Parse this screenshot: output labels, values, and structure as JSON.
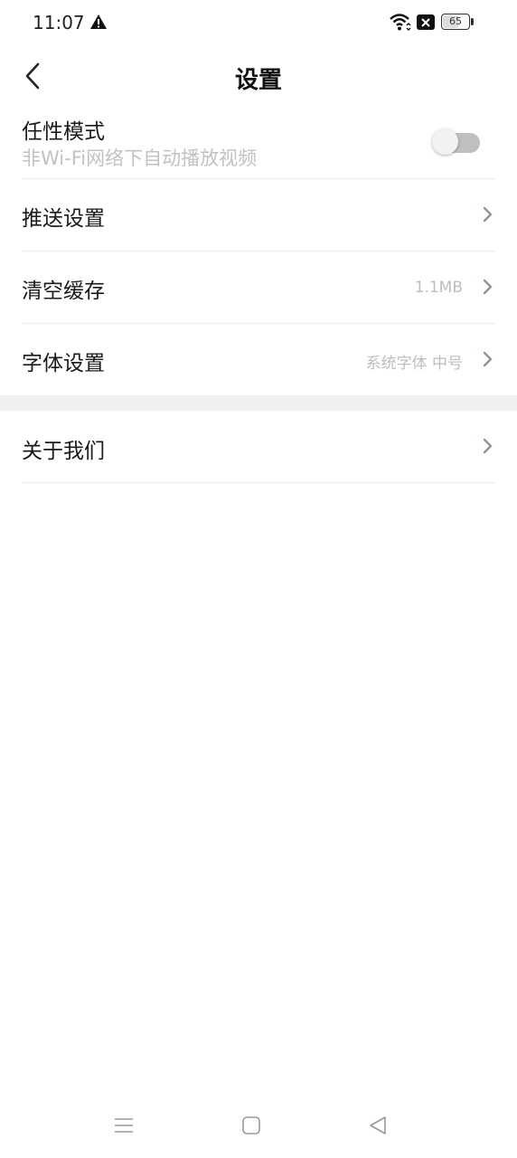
{
  "status": {
    "time": "11:07",
    "battery": "65",
    "icons": [
      "warning-icon",
      "wifi-icon",
      "no-sim-icon",
      "battery-icon"
    ]
  },
  "header": {
    "title": "设置",
    "back_icon": "chevron-left-icon"
  },
  "settings": {
    "mode": {
      "label": "任性模式",
      "sublabel": "非Wi-Fi网络下自动播放视频",
      "enabled": false
    },
    "push": {
      "label": "推送设置"
    },
    "cache": {
      "label": "清空缓存",
      "value": "1.1MB"
    },
    "font": {
      "label": "字体设置",
      "value": "系统字体 中号"
    },
    "about": {
      "label": "关于我们"
    }
  },
  "system_nav": [
    "menu-icon",
    "home-icon",
    "back-triangle-icon"
  ],
  "colors": {
    "divider": "#ececec",
    "section_gap": "#efefef",
    "value_text": "#bdbdbd",
    "chevron": "#8a96a3"
  }
}
